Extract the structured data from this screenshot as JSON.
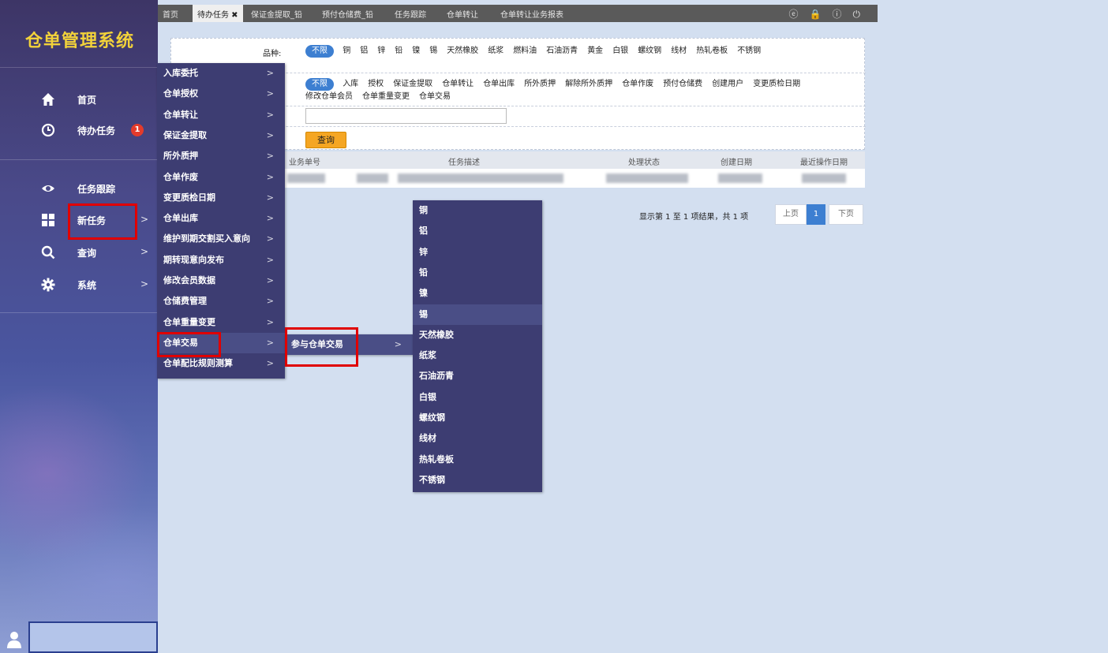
{
  "app": {
    "title": "仓单管理系统"
  },
  "sidebar": {
    "items": [
      {
        "label": "首页",
        "icon": "home-icon"
      },
      {
        "label": "待办任务",
        "icon": "clock-icon",
        "badge": "1"
      },
      {
        "label": "任务跟踪",
        "icon": "eye-icon"
      },
      {
        "label": "新任务",
        "icon": "grid-icon",
        "arrow": ">"
      },
      {
        "label": "查询",
        "icon": "search-icon",
        "arrow": ">"
      },
      {
        "label": "系统",
        "icon": "gear-icon",
        "arrow": ">"
      }
    ]
  },
  "tabs": [
    "首页",
    "待办任务 ✖",
    "保证金提取_铅",
    "预付仓储费_铅",
    "任务跟踪",
    "仓单转让",
    "仓单转让业务报表"
  ],
  "top_icons": [
    "ⓔ",
    "🔒",
    "ⓘ",
    "⏻"
  ],
  "filter": {
    "variety_label": "品种:",
    "variety_default": "不限",
    "varieties": [
      "铜",
      "铝",
      "锌",
      "铅",
      "镍",
      "锡",
      "天然橡胶",
      "纸浆",
      "燃料油",
      "石油沥青",
      "黄金",
      "白银",
      "螺纹钢",
      "线材",
      "热轧卷板",
      "不锈钢"
    ],
    "type_default": "不限",
    "types": [
      "入库",
      "授权",
      "保证金提取",
      "仓单转让",
      "仓单出库",
      "所外质押",
      "解除所外质押",
      "仓单作废",
      "预付仓储费",
      "创建用户",
      "变更质检日期",
      "修改仓单会员",
      "仓单重量变更",
      "仓单交易"
    ],
    "query_button": "查询"
  },
  "table": {
    "columns": [
      "业务单号",
      "任务描述",
      "处理状态",
      "创建日期",
      "最近操作日期"
    ]
  },
  "pager": {
    "summary": "显示第 1 至 1 项结果，共 1 项",
    "prev": "上页",
    "current": "1",
    "next": "下页"
  },
  "menu1": {
    "items": [
      "入库委托",
      "仓单授权",
      "仓单转让",
      "保证金提取",
      "所外质押",
      "仓单作废",
      "变更质检日期",
      "仓单出库",
      "维护到期交割买入意向",
      "期转现意向发布",
      "修改会员数据",
      "仓储费管理",
      "仓单重量变更",
      "仓单交易",
      "仓单配比规则测算"
    ],
    "arrow": ">"
  },
  "menu2": {
    "items": [
      "参与仓单交易"
    ],
    "arrow": ">"
  },
  "menu3": {
    "items": [
      "铜",
      "铝",
      "锌",
      "铅",
      "镍",
      "锡",
      "天然橡胶",
      "纸浆",
      "石油沥青",
      "白银",
      "螺纹钢",
      "线材",
      "热轧卷板",
      "不锈钢"
    ]
  },
  "colors": {
    "sidebar_top": "#3d3566",
    "menu_bg": "#3d3d72",
    "accent": "#3d7fd1",
    "highlight": "#e00000",
    "query_button": "#f5a623"
  }
}
